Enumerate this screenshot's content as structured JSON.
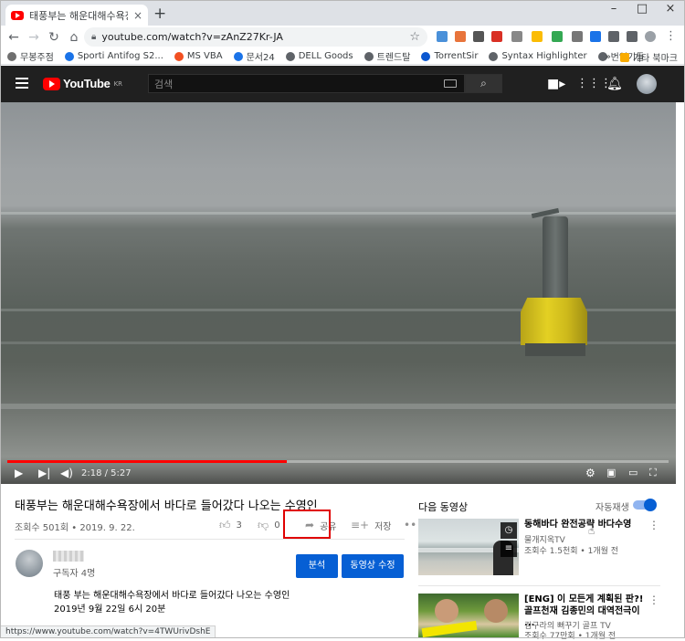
{
  "browser": {
    "tab_title": "태풍부는 해운대해수욕장에",
    "tab_close": "×",
    "new_tab": "+",
    "win_min": "–",
    "win_max": "□",
    "win_close": "×",
    "url": "youtube.com/watch?v=zAnZ27Kr-JA",
    "bookmarks": [
      {
        "label": "무봉주점",
        "color": "#6f6f6f"
      },
      {
        "label": "Sporti Antifog S2...",
        "color": "#1a73e8"
      },
      {
        "label": "MS VBA",
        "color": "#f25022"
      },
      {
        "label": "문서24",
        "color": "#1a73e8"
      },
      {
        "label": "DELL Goods",
        "color": "#5f6368"
      },
      {
        "label": "트렌드탈",
        "color": "#5f6368"
      },
      {
        "label": "TorrentSir",
        "color": "#0b57d0"
      },
      {
        "label": "Syntax Highlighter",
        "color": "#5f6368"
      },
      {
        "label": "번역기들",
        "color": "#5f6368"
      }
    ],
    "bookmarks_more": "»",
    "other_bookmarks": "기타 북마크",
    "status_url": "https://www.youtube.com/watch?v=4TWUrivDshE"
  },
  "masthead": {
    "logo_text": "YouTube",
    "region": "KR",
    "search_placeholder": "검색"
  },
  "video": {
    "time": "2:18 / 5:27",
    "progress": 0.422,
    "title": "태풍부는 해운대해수욕장에서 바다로 들어갔다 나오는 수영인",
    "views_date": "조회수 501회 • 2019. 9. 22.",
    "likes": "3",
    "dislikes": "0",
    "share": "공유",
    "save": "저장",
    "more": "•••"
  },
  "channel": {
    "subs": "구독자 4명",
    "analytics_button": "분석",
    "edit_button": "동영상 수정",
    "description_line1": "태풍 부는 해운대해수욕장에서 바다로 들어갔다 나오는 수영인",
    "description_line2": "2019년 9월 22일 6시 20분"
  },
  "sidebar": {
    "up_next": "다음 동영상",
    "autoplay": "자동재생",
    "autoplay_on": true,
    "recs": [
      {
        "title": "동해바다 완전공략 바다수영",
        "channel": "물개지옥TV",
        "views": "조회수 1.5천회 • 1개월 전"
      },
      {
        "title": "[ENG] 이 모든게 계획된 판?! 골프천재 김종민의 대역전극이 ...",
        "channel": "김구라의 뻐꾸기 골프 TV",
        "views": "조회수 77만회 • 1개월 전"
      }
    ]
  }
}
